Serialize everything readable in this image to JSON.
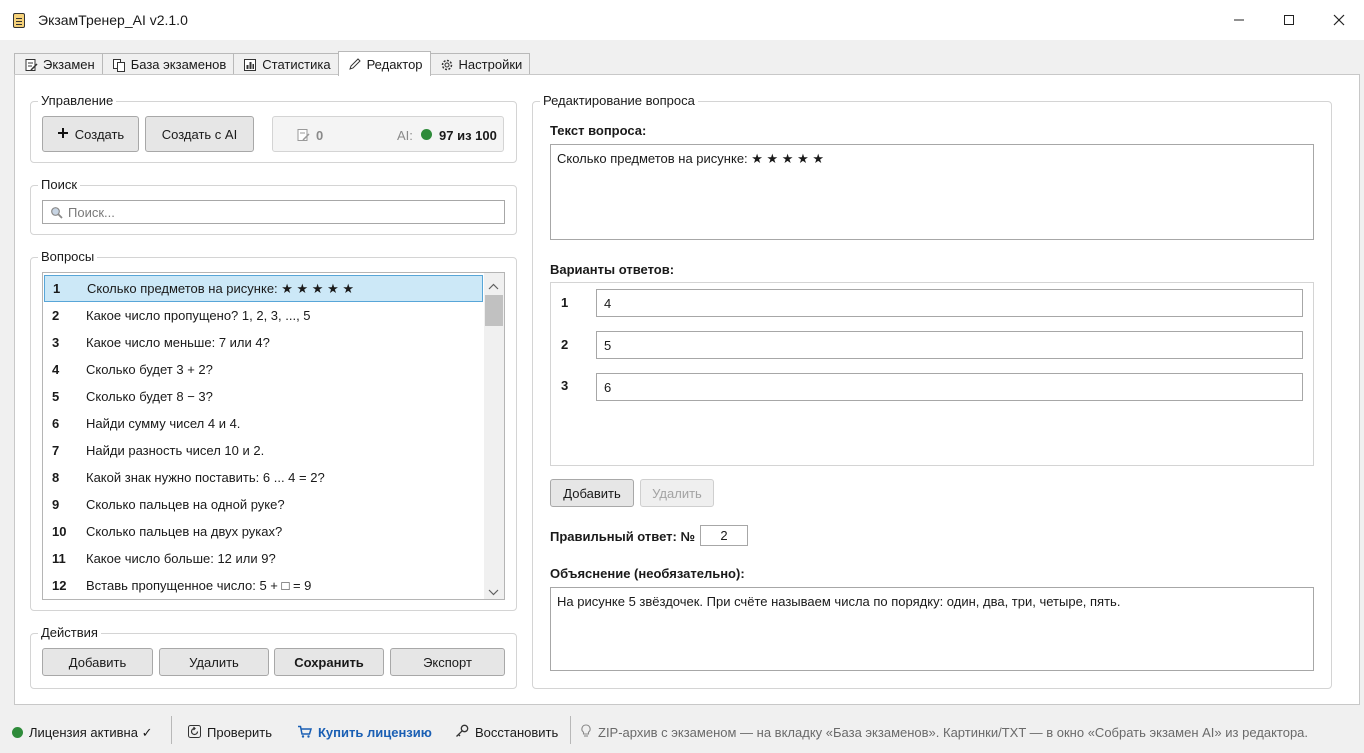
{
  "window": {
    "title": "ЭкзамТренер_AI v2.1.0"
  },
  "tabs": [
    {
      "label": "Экзамен",
      "icon": "edit-doc-icon"
    },
    {
      "label": "База экзаменов",
      "icon": "copy-docs-icon"
    },
    {
      "label": "Статистика",
      "icon": "bar-chart-icon"
    },
    {
      "label": "Редактор",
      "icon": "pencil-icon",
      "active": true
    },
    {
      "label": "Настройки",
      "icon": "gear-icon"
    }
  ],
  "control": {
    "group_label": "Управление",
    "create_label": "Создать",
    "create_ai_label": "Создать с AI",
    "draft_count": "0",
    "ai_prefix": "AI:",
    "ai_quota": "97 из 100",
    "ai_status_color": "#2e8b3a"
  },
  "search": {
    "group_label": "Поиск",
    "placeholder": "Поиск..."
  },
  "questions": {
    "group_label": "Вопросы",
    "selected_index": 0,
    "items": [
      {
        "num": "1",
        "text": "Сколько предметов на рисунке: ★ ★ ★ ★ ★"
      },
      {
        "num": "2",
        "text": "Какое число пропущено? 1, 2, 3, ..., 5"
      },
      {
        "num": "3",
        "text": "Какое число меньше: 7 или 4?"
      },
      {
        "num": "4",
        "text": "Сколько будет 3 + 2?"
      },
      {
        "num": "5",
        "text": "Сколько будет 8 − 3?"
      },
      {
        "num": "6",
        "text": "Найди сумму чисел 4 и 4."
      },
      {
        "num": "7",
        "text": "Найди разность чисел 10 и 2."
      },
      {
        "num": "8",
        "text": "Какой знак нужно поставить: 6 ... 4 = 2?"
      },
      {
        "num": "9",
        "text": "Сколько пальцев на одной руке?"
      },
      {
        "num": "10",
        "text": "Сколько пальцев на двух руках?"
      },
      {
        "num": "11",
        "text": "Какое число больше: 12 или 9?"
      },
      {
        "num": "12",
        "text": "Вставь пропущенное число: 5 + □ = 9"
      }
    ]
  },
  "actions": {
    "group_label": "Действия",
    "add_label": "Добавить",
    "delete_label": "Удалить",
    "save_label": "Сохранить",
    "export_label": "Экспорт"
  },
  "editor": {
    "group_label": "Редактирование вопроса",
    "question_label": "Текст вопроса:",
    "question_text": "Сколько предметов на рисунке: ★ ★ ★ ★ ★",
    "answers_label": "Варианты ответов:",
    "answers": [
      {
        "num": "1",
        "value": "4"
      },
      {
        "num": "2",
        "value": "5"
      },
      {
        "num": "3",
        "value": "6"
      }
    ],
    "add_answer_label": "Добавить",
    "delete_answer_label": "Удалить",
    "correct_label": "Правильный ответ: №",
    "correct_value": "2",
    "explanation_label": "Объяснение (необязательно):",
    "explanation_text": "На рисунке 5 звёздочек. При счёте называем числа по порядку: один, два, три, четыре, пять."
  },
  "status": {
    "license_text": "Лицензия активна ✓",
    "license_color": "#2e8b3a",
    "check_label": "Проверить",
    "buy_label": "Купить лицензию",
    "restore_label": "Восстановить",
    "hint": "ZIP-архив с экзаменом — на вкладку «База экзаменов». Картинки/TXT — в окно «Собрать экзамен AI» из редактора."
  }
}
